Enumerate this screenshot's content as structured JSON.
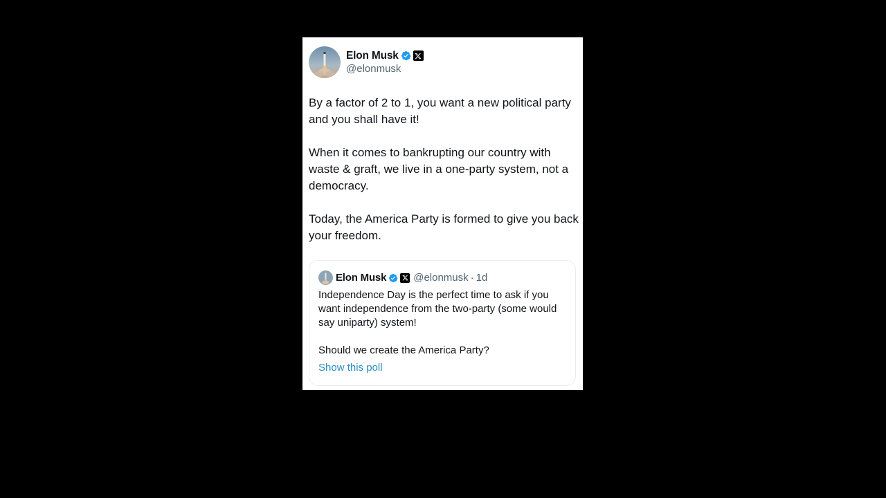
{
  "tweet": {
    "author": {
      "name": "Elon Musk",
      "handle": "@elonmusk",
      "avatar_icon": "rocket-launch-avatar-icon",
      "verified_icon": "verified-badge-icon",
      "affiliation_icon": "x-logo-icon"
    },
    "paragraphs": [
      "By a factor of 2 to 1, you want a new political party and you shall have it!",
      "When it comes to bankrupting our country with waste & graft, we live in a one-party system, not a democracy.",
      "Today, the America Party is formed to give you back your freedom."
    ],
    "quoted": {
      "name": "Elon Musk",
      "handle": "@elonmusk",
      "separator": "·",
      "time": "1d",
      "paragraphs": [
        "Independence Day is the perfect time to ask if you want independence from the two-party (some would say uniparty) system!",
        "Should we create the America Party?"
      ],
      "link_label": "Show this poll"
    }
  },
  "colors": {
    "background": "#000000",
    "card": "#ffffff",
    "text": "#0f1419",
    "muted": "#536471",
    "verified": "#1d9bf0",
    "link": "#2b8ec4"
  }
}
